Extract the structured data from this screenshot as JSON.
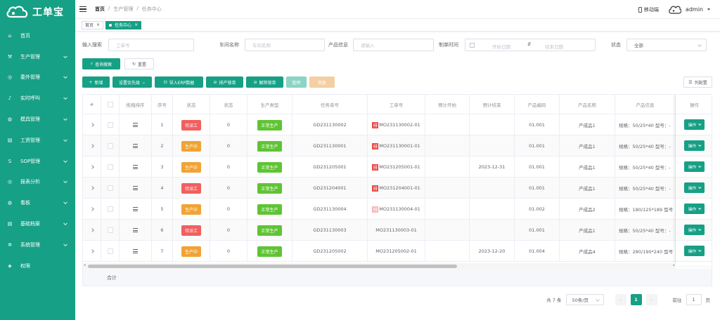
{
  "app": {
    "logo_text": "工单宝"
  },
  "sidebar": {
    "items": [
      {
        "label": "首页",
        "icon": "home-icon",
        "has_children": false
      },
      {
        "label": "生产管理",
        "icon": "production-icon",
        "has_children": true
      },
      {
        "label": "委外管理",
        "icon": "outsource-icon",
        "has_children": true
      },
      {
        "label": "实时呼叫",
        "icon": "bell-icon",
        "has_children": true
      },
      {
        "label": "模具管理",
        "icon": "mold-icon",
        "has_children": true
      },
      {
        "label": "工资管理",
        "icon": "wage-icon",
        "has_children": true
      },
      {
        "label": "SOP管理",
        "icon": "sop-icon",
        "has_children": true
      },
      {
        "label": "报表分析",
        "icon": "report-icon",
        "has_children": true
      },
      {
        "label": "看板",
        "icon": "board-icon",
        "has_children": true
      },
      {
        "label": "基础档案",
        "icon": "archive-icon",
        "has_children": true
      },
      {
        "label": "系统管理",
        "icon": "gear-icon",
        "has_children": true
      },
      {
        "label": "权限",
        "icon": "shield-icon",
        "has_children": false
      }
    ]
  },
  "header": {
    "breadcrumb": [
      "首页",
      "生产管理",
      "任务中心"
    ],
    "mobile_label": "移动端",
    "username": "admin"
  },
  "tags": [
    {
      "label": "首页",
      "active": false
    },
    {
      "label": "任务中心",
      "active": true
    }
  ],
  "search": {
    "input_label": "输入搜索",
    "input_placeholder": "工单号",
    "workshop_label": "车间名称",
    "workshop_placeholder": "车间名称",
    "product_label": "产品信息",
    "product_placeholder": "请输入",
    "time_label": "制单时间",
    "start_placeholder": "开始日期",
    "end_placeholder": "结束日期",
    "status_label": "状态",
    "status_value": "全部",
    "query_button": "查询搜索",
    "reset_button": "重置"
  },
  "toolbar": {
    "add": "新增",
    "priority": "设置优先级",
    "import": "导入ERP数据",
    "lock": "排产锁单",
    "unlock": "解除锁单",
    "pause": "暂停",
    "resume": "恢复",
    "columns": "列配置"
  },
  "table": {
    "columns": [
      "#",
      "",
      "拖拽排序",
      "序号",
      "状态",
      "状态",
      "生产类型",
      "任务单号",
      "工单号",
      "预计开始",
      "预计结束",
      "产品编码",
      "产品名称",
      "产品信息",
      "操作"
    ],
    "rows": [
      {
        "seq": "1",
        "status": "待派工",
        "status_color": "red",
        "count": "0",
        "type": "正常生产",
        "task_no": "GD231130002",
        "order_flag": "red",
        "order_no": "MO231130002-01",
        "start": "",
        "end": "",
        "code": "01.001",
        "name": "产成品1",
        "info": "规格：50/25*40 型号：-"
      },
      {
        "seq": "2",
        "status": "生产中",
        "status_color": "orange",
        "count": "0",
        "type": "正常生产",
        "task_no": "GD231130001",
        "order_flag": "red",
        "order_no": "MO231130001-01",
        "start": "",
        "end": "",
        "code": "01.001",
        "name": "产成品1",
        "info": "规格：50/25*40 型号：-"
      },
      {
        "seq": "3",
        "status": "生产中",
        "status_color": "orange",
        "count": "0",
        "type": "正常生产",
        "task_no": "GD231205001",
        "order_flag": "red",
        "order_no": "MO231205001-01",
        "start": "",
        "end": "2023-12-31",
        "code": "01.001",
        "name": "产成品1",
        "info": "规格：50/25*40 型号：-"
      },
      {
        "seq": "4",
        "status": "待派工",
        "status_color": "red",
        "count": "0",
        "type": "正常生产",
        "task_no": "GD231204001",
        "order_flag": "red",
        "order_no": "MO231204001-01",
        "start": "",
        "end": "",
        "code": "01.001",
        "name": "产成品1",
        "info": "规格：50/25*40 型号：-"
      },
      {
        "seq": "5",
        "status": "生产中",
        "status_color": "orange",
        "count": "0",
        "type": "正常生产",
        "task_no": "GD231130004",
        "order_flag": "pale",
        "order_no": "MO231130004-01",
        "start": "",
        "end": "",
        "code": "01.002",
        "name": "产成品2",
        "info": "规格：180/125*189 型号"
      },
      {
        "seq": "6",
        "status": "待派工",
        "status_color": "red",
        "count": "0",
        "type": "正常生产",
        "task_no": "GD231130003",
        "order_flag": "none",
        "order_no": "MO231130003-01",
        "start": "",
        "end": "",
        "code": "01.001",
        "name": "产成品1",
        "info": "规格：50/25*40 型号：-"
      },
      {
        "seq": "7",
        "status": "生产中",
        "status_color": "orange",
        "count": "0",
        "type": "正常生产",
        "task_no": "GD231205002",
        "order_flag": "none",
        "order_no": "MO231205002-01",
        "start": "",
        "end": "2023-12-20",
        "code": "01.004",
        "name": "产成品4",
        "info": "规格：280/190*240 型号"
      }
    ],
    "order_flag_glyph": "排",
    "op_label": "操作",
    "sum_label": "合计"
  },
  "pagination": {
    "total": "共 7 条",
    "page_size": "50条/页",
    "current_page": "1",
    "jump_label": "前往",
    "jump_value": "1",
    "jump_suffix": "页"
  },
  "colors": {
    "brand": "#16a085",
    "red": "#f0605f",
    "orange": "#f0a336",
    "green": "#5fc434"
  }
}
